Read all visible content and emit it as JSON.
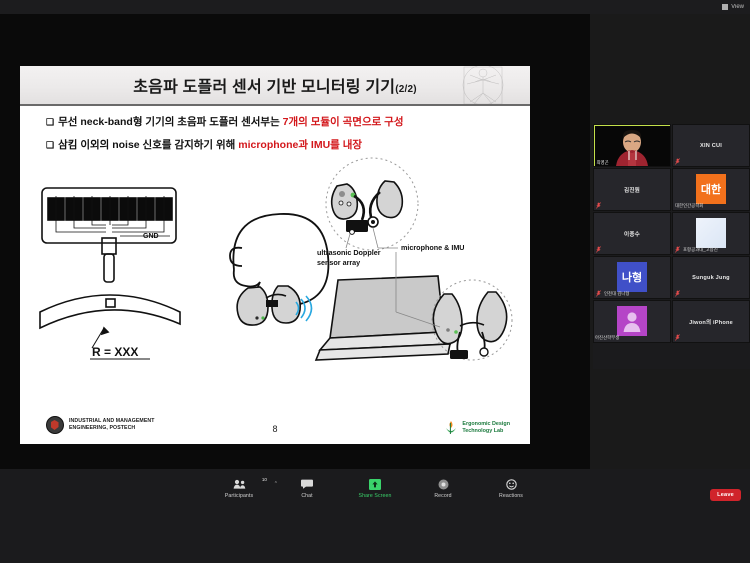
{
  "topbar": {
    "view_label": "View",
    "view_icon": "grid-view-icon"
  },
  "slide": {
    "title": "초음파 도플러 센서 기반 모니터링 기기",
    "title_fraction": "(2/2)",
    "bullets": [
      {
        "marker": "❑",
        "pre": "무선 neck-band형 기기의 초음파 도플러 센서부는 ",
        "highlight": "7개의 모듈이 곡면으로 구성",
        "post": ""
      },
      {
        "marker": "❑",
        "pre": "삼킴 이외의 noise 신호를 감지하기 위해 ",
        "highlight": "microphone과 IMU를 내장",
        "post": ""
      }
    ],
    "annotations": {
      "sensor_array": "ultrasonic Doppler\nsensor array",
      "sensor_array_line1": "ultrasonic Doppler",
      "sensor_array_line2": "sensor array",
      "mic_imu": "microphone & IMU",
      "gnd": "GND",
      "radius": "R = XXX"
    },
    "footer_left_line1": "INDUSTRIAL AND MANAGEMENT",
    "footer_left_line2": "ENGINEERING, POSTECH",
    "page_number": "8",
    "footer_right_line1": "Ergonomic Design",
    "footer_right_line2": "Technology Lab",
    "highlight_color": "#d3171b"
  },
  "participants": {
    "tiles": [
      {
        "name": "최영곤",
        "kind": "video",
        "label": "최영곤",
        "active_speaker": true,
        "muted": false
      },
      {
        "name": "XIN CUI",
        "kind": "name",
        "label": "",
        "muted": true
      },
      {
        "name": "김진원",
        "kind": "name",
        "label": "",
        "muted": true
      },
      {
        "name": "대한인간공학회",
        "kind": "avatar-orange",
        "avatar_text": "대한",
        "label": "대한인간공학회",
        "muted": false
      },
      {
        "name": "이종수",
        "kind": "name",
        "label": "",
        "muted": true
      },
      {
        "name": "포항공과대_고용진",
        "kind": "avatar-white",
        "avatar_text": "",
        "label": "포항공과대_고용진",
        "muted": true
      },
      {
        "name": "인천대 김나형",
        "kind": "avatar-blue",
        "avatar_text": "나형",
        "label": "인천대 김나형",
        "muted": true
      },
      {
        "name": "Sunguk Jung",
        "kind": "name",
        "label": "",
        "muted": true
      },
      {
        "name": "아진산학부생",
        "kind": "avatar-purple",
        "avatar_text": "",
        "label": "아진산학부생",
        "muted": false
      },
      {
        "name": "Jiwon의 iPhone",
        "kind": "name",
        "label": "",
        "muted": true
      }
    ]
  },
  "toolbar": {
    "participants_label": "Participants",
    "participants_count": "10",
    "chat_label": "Chat",
    "share_label": "Share Screen",
    "record_label": "Record",
    "reactions_label": "Reactions",
    "leave_label": "Leave",
    "share_accent": "#3ad36b",
    "leave_color": "#d0242b"
  }
}
